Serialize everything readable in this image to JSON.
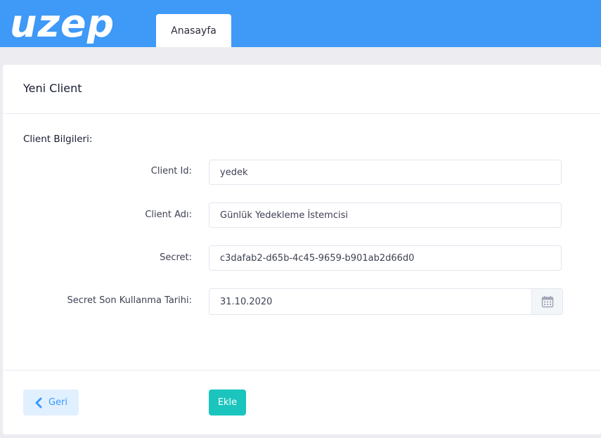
{
  "header": {
    "logo_text": "UZEP",
    "tabs": [
      {
        "label": "Anasayfa"
      }
    ],
    "brand_color": "#3e99f7"
  },
  "card": {
    "title": "Yeni Client",
    "section_title": "Client Bilgileri:",
    "fields": [
      {
        "label": "Client Id:",
        "value": "yedek"
      },
      {
        "label": "Client Adı:",
        "value": "Günlük Yedekleme İstemcisi"
      },
      {
        "label": "Secret:",
        "value": "c3dafab2-d65b-4c45-9659-b901ab2d66d0"
      },
      {
        "label": "Secret Son Kullanma Tarihi:",
        "value": "31.10.2020",
        "addon_icon": "calendar-icon"
      }
    ],
    "buttons": {
      "back_label": "Geri",
      "back_icon": "chevron-left-icon",
      "add_label": "Ekle"
    }
  }
}
